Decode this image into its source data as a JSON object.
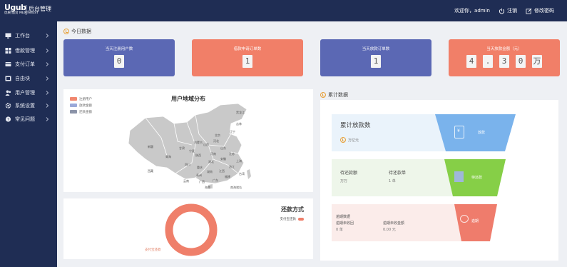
{
  "header": {
    "logo_mark": "Ugub",
    "logo_sub": "优果|借贷 MEXTAREST",
    "logo_title": "后台管理",
    "welcome": "欢迎你，admin",
    "logout_label": "注销",
    "change_password_label": "修改密码"
  },
  "sidebar": {
    "items": [
      {
        "label": "工作台",
        "icon": "monitor-icon"
      },
      {
        "label": "借款管理",
        "icon": "grid-icon"
      },
      {
        "label": "支付订单",
        "icon": "card-icon"
      },
      {
        "label": "自由块",
        "icon": "block-icon"
      },
      {
        "label": "用户管理",
        "icon": "users-icon"
      },
      {
        "label": "系统设置",
        "icon": "gear-icon"
      },
      {
        "label": "常见问题",
        "icon": "question-icon"
      }
    ]
  },
  "today": {
    "title": "今日数据",
    "cards": [
      {
        "label": "当天注册用户数",
        "digits": [
          "0"
        ],
        "color": "#5b68b4"
      },
      {
        "label": "借款申请订单数",
        "digits": [
          "1"
        ],
        "color": "#f17f68"
      },
      {
        "label": "当天放款订单数",
        "digits": [
          "1"
        ],
        "color": "#5b68b4"
      },
      {
        "label": "当天放款金额（元）",
        "digits": [
          "4",
          ".",
          "3",
          "0",
          "万"
        ],
        "color": "#f17f68"
      }
    ]
  },
  "map": {
    "title": "用户地域分布",
    "legend": [
      {
        "label": "注册用户",
        "color": "#f0876f"
      },
      {
        "label": "放款金额",
        "color": "#9aa9d9"
      },
      {
        "label": "还款金额",
        "color": "#8b93a8"
      }
    ],
    "provinces": [
      "新疆",
      "西藏",
      "青海",
      "甘肃",
      "内蒙古",
      "黑龙江",
      "吉林",
      "辽宁",
      "北京",
      "河北",
      "山西",
      "山东",
      "河南",
      "陕西",
      "宁夏",
      "四川",
      "重庆",
      "湖北",
      "安徽",
      "江苏",
      "上海",
      "浙江",
      "湖南",
      "江西",
      "福建",
      "贵州",
      "云南",
      "广西",
      "广东",
      "台湾",
      "海南",
      "南海诸岛"
    ]
  },
  "repayment": {
    "title": "还款方式",
    "legend_label": "支付宝还款",
    "slice_label": "支付宝还款",
    "color": "#ef7f6a"
  },
  "cumulative": {
    "title": "累计数据",
    "rows": [
      {
        "title": "累计放款数",
        "sub": "万亿元",
        "trap_label": "放款",
        "bg": "#eaf3fb",
        "trap": "#7ab3ec"
      },
      {
        "label1": "待还款额",
        "value1": "万万",
        "label2": "待还款单",
        "value2": "1 单",
        "trap_label": "待还款",
        "bg": "#eef6ea",
        "trap": "#86cf47"
      },
      {
        "label1": "逾期数据",
        "label1b": "逾期未收回",
        "value1": "0 单",
        "label2": "逾期未收金额",
        "value2": "0.00 元",
        "trap_label": "逾期",
        "bg": "#fbecea",
        "trap": "#ef7c6c"
      }
    ]
  }
}
